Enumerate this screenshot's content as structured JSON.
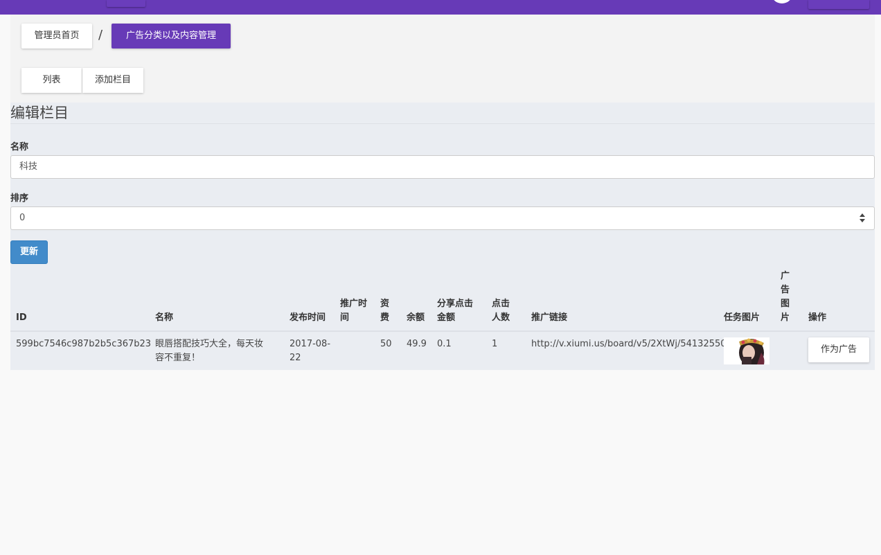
{
  "breadcrumb": {
    "home": "管理员首页",
    "separator": "/",
    "current": "广告分类以及内容管理"
  },
  "tabs": {
    "list": "列表",
    "add": "添加栏目"
  },
  "form": {
    "title": "编辑栏目",
    "name_label": "名称",
    "name_value": "科技",
    "order_label": "排序",
    "order_value": "0",
    "submit": "更新"
  },
  "table": {
    "headers": {
      "id": "ID",
      "name": "名称",
      "published": "发布时间",
      "promo_time_1": "推广时",
      "promo_time_2": "间",
      "fee_1": "资",
      "fee_2": "费",
      "balance": "余额",
      "share_1": "分享点击",
      "share_2": "金额",
      "clicks_1": "点击",
      "clicks_2": "人数",
      "link": "推广链接",
      "task_image": "任务图片",
      "ad_image_1": "广",
      "ad_image_2": "告",
      "ad_image_3": "图",
      "ad_image_4": "片",
      "actions": "操作"
    },
    "row": {
      "id": "599bc7546c987b2b5c367b23",
      "name_1": "眼唇搭配技巧大全，每天妆",
      "name_2": "容不重复！",
      "published_1": "2017-08-",
      "published_2": "22",
      "promo_time": "",
      "fee": "50",
      "balance": "49.9",
      "share": "0.1",
      "clicks": "1",
      "link": "http://v.xiumi.us/board/v5/2XtWj/54132550",
      "action": "作为广告"
    }
  },
  "colors": {
    "topbar": "#673ab7",
    "accent": "#673ab7",
    "primary_button": "#428bca",
    "panel": "#eaedf2"
  }
}
